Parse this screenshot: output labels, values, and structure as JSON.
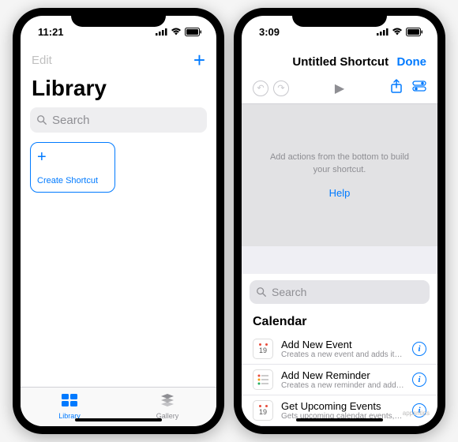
{
  "phone1": {
    "status": {
      "time": "11:21"
    },
    "nav": {
      "edit": "Edit",
      "plus": "+"
    },
    "title": "Library",
    "search": {
      "placeholder": "Search"
    },
    "create": {
      "plus": "+",
      "label": "Create Shortcut"
    },
    "tabs": {
      "library": "Library",
      "gallery": "Gallery"
    }
  },
  "phone2": {
    "status": {
      "time": "3:09"
    },
    "nav": {
      "title": "Untitled Shortcut",
      "done": "Done"
    },
    "canvas": {
      "text": "Add actions from the bottom to build your shortcut.",
      "help": "Help"
    },
    "search": {
      "placeholder": "Search"
    },
    "section": "Calendar",
    "actions": [
      {
        "title": "Add New Event",
        "sub": "Creates a new event and adds it to the sel...",
        "day": "19"
      },
      {
        "title": "Add New Reminder",
        "sub": "Creates a new reminder and adds it to the...",
        "day": ""
      },
      {
        "title": "Get Upcoming Events",
        "sub": "Gets upcoming calendar events, ordered fr...",
        "day": "19"
      }
    ]
  },
  "watermark": "appsntips"
}
